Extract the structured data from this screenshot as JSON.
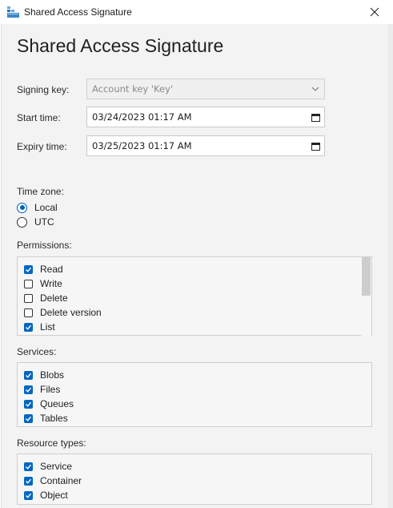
{
  "window": {
    "title": "Shared Access Signature",
    "close_glyph": "✕"
  },
  "dialog": {
    "heading": "Shared Access Signature",
    "signing_key": {
      "label": "Signing key:",
      "value": "Account key 'Key'"
    },
    "start_time": {
      "label": "Start time:",
      "value": "03/24/2023  01:17  AM"
    },
    "expiry_time": {
      "label": "Expiry time:",
      "value": "03/25/2023  01:17  AM"
    },
    "time_zone": {
      "label": "Time zone:",
      "options": [
        {
          "label": "Local",
          "selected": true
        },
        {
          "label": "UTC",
          "selected": false
        }
      ]
    },
    "permissions": {
      "label": "Permissions:",
      "items": [
        {
          "label": "Read",
          "checked": true
        },
        {
          "label": "Write",
          "checked": false
        },
        {
          "label": "Delete",
          "checked": false
        },
        {
          "label": "Delete version",
          "checked": false
        },
        {
          "label": "List",
          "checked": true
        }
      ]
    },
    "services": {
      "label": "Services:",
      "items": [
        {
          "label": "Blobs",
          "checked": true
        },
        {
          "label": "Files",
          "checked": true
        },
        {
          "label": "Queues",
          "checked": true
        },
        {
          "label": "Tables",
          "checked": true
        }
      ]
    },
    "resource_types": {
      "label": "Resource types:",
      "items": [
        {
          "label": "Service",
          "checked": true
        },
        {
          "label": "Container",
          "checked": true
        },
        {
          "label": "Object",
          "checked": true
        }
      ]
    }
  },
  "colors": {
    "accent": "#0067c0",
    "background": "#f3f3f3"
  },
  "icons": {
    "app": "storage-explorer-icon",
    "dropdown": "chevron-down-icon",
    "date": "calendar-icon",
    "close": "close-icon"
  }
}
